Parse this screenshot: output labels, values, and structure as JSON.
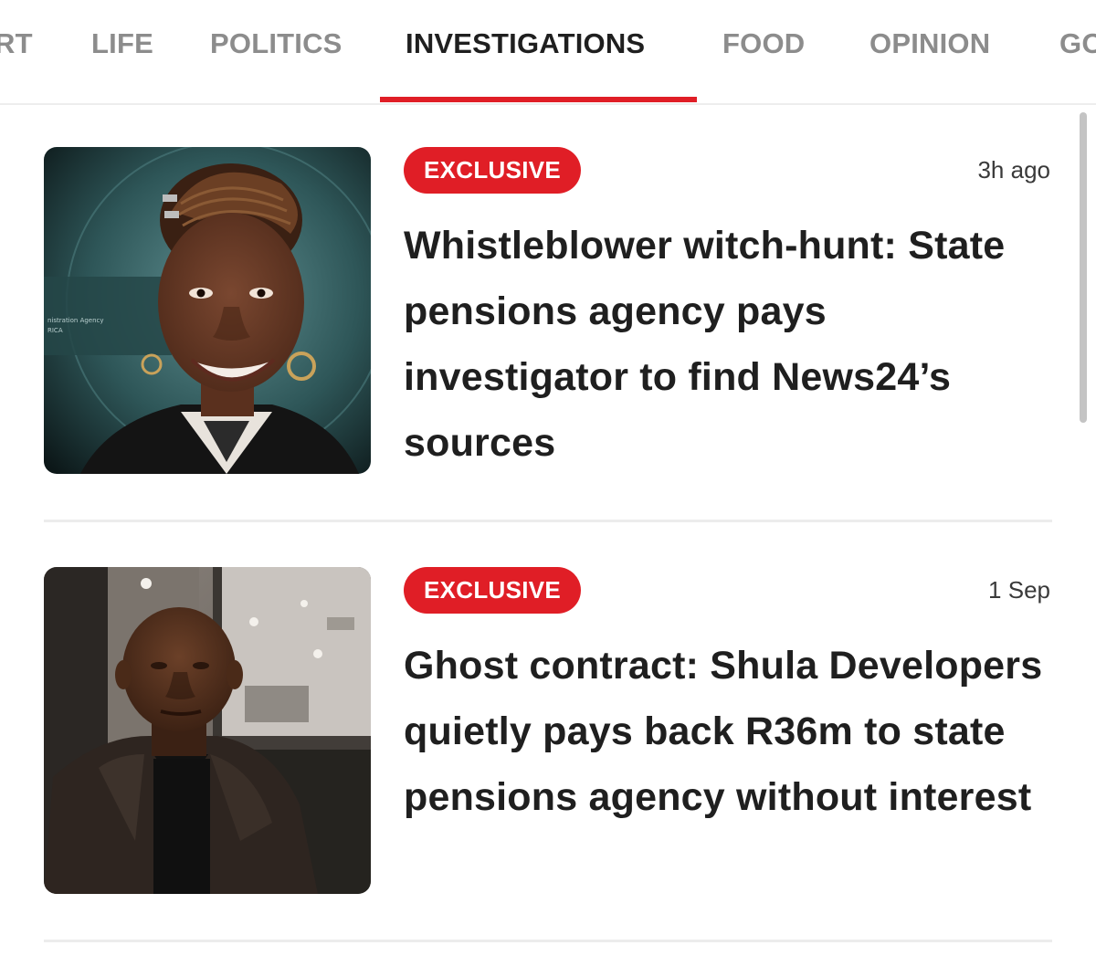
{
  "nav": {
    "items": [
      {
        "label": "RT"
      },
      {
        "label": "LIFE"
      },
      {
        "label": "POLITICS"
      },
      {
        "label": "INVESTIGATIONS",
        "active": true
      },
      {
        "label": "FOOD"
      },
      {
        "label": "OPINION"
      },
      {
        "label": "GO"
      }
    ]
  },
  "colors": {
    "accent": "#e01e26",
    "nav_inactive": "#8c8c8c",
    "text": "#1f1f1f"
  },
  "articles": [
    {
      "badge": "EXCLUSIVE",
      "time": "3h ago",
      "headline": "Whistleblower witch-hunt: State pensions agency pays investigator to find News24’s sources",
      "image_caption": [
        "nistration Agency",
        "RICA"
      ]
    },
    {
      "badge": "EXCLUSIVE",
      "time": "1 Sep",
      "headline": "Ghost contract: Shula Developers quietly pays back R36m to state pensions agency without interest"
    }
  ]
}
